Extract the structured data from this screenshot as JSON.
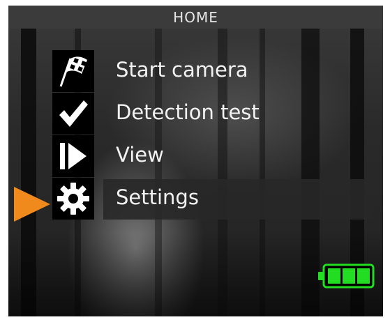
{
  "header": {
    "title": "HOME"
  },
  "menu": {
    "items": [
      {
        "label": "Start camera",
        "icon": "checkered-flag-icon",
        "selected": false
      },
      {
        "label": "Detection test",
        "icon": "checkmark-icon",
        "selected": false
      },
      {
        "label": "View",
        "icon": "play-icon",
        "selected": false
      },
      {
        "label": "Settings",
        "icon": "gear-icon",
        "selected": true
      }
    ]
  },
  "status": {
    "battery_level": 1.0
  },
  "colors": {
    "selection_pointer": "#f08a1c",
    "battery": "#22dd22",
    "title_bar": "#3b3b3b",
    "text": "#f2f2f2"
  }
}
